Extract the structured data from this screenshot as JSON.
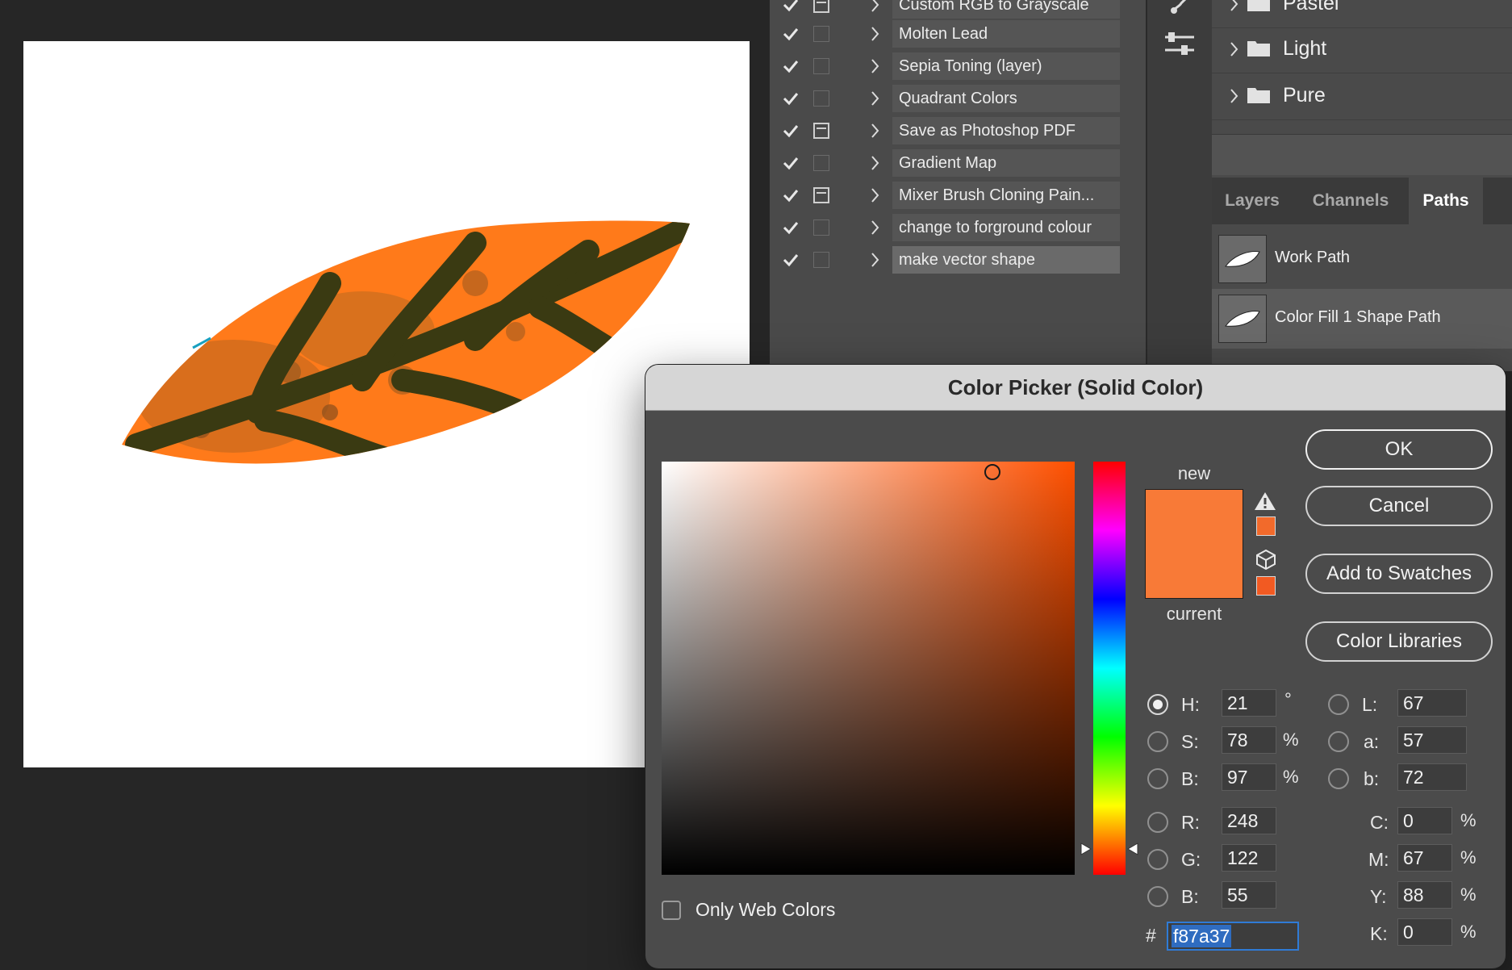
{
  "canvas": {},
  "actions": [
    {
      "label": "Custom RGB to Grayscale",
      "dialog": true
    },
    {
      "label": "Molten Lead",
      "dialog": false
    },
    {
      "label": "Sepia Toning (layer)",
      "dialog": false
    },
    {
      "label": "Quadrant Colors",
      "dialog": false
    },
    {
      "label": "Save as Photoshop PDF",
      "dialog": true
    },
    {
      "label": "Gradient Map",
      "dialog": false
    },
    {
      "label": "Mixer Brush Cloning Pain...",
      "dialog": true
    },
    {
      "label": "change to forground colour",
      "dialog": false
    },
    {
      "label": "make vector shape",
      "dialog": false,
      "selected": true
    }
  ],
  "swatch_groups": [
    "Pastel",
    "Light",
    "Pure"
  ],
  "panel_tabs": [
    "Layers",
    "Channels",
    "Paths"
  ],
  "paths": [
    "Work Path",
    "Color Fill 1 Shape Path"
  ],
  "dialog": {
    "title": "Color Picker (Solid Color)",
    "new_label": "new",
    "current_label": "current",
    "buttons": {
      "ok": "OK",
      "cancel": "Cancel",
      "add_swatches": "Add to Swatches",
      "color_libraries": "Color Libraries"
    },
    "hsb": {
      "h": {
        "label": "H:",
        "value": "21",
        "unit": "°"
      },
      "s": {
        "label": "S:",
        "value": "78",
        "unit": "%"
      },
      "b": {
        "label": "B:",
        "value": "97",
        "unit": "%"
      }
    },
    "rgb": {
      "r": {
        "label": "R:",
        "value": "248"
      },
      "g": {
        "label": "G:",
        "value": "122"
      },
      "b": {
        "label": "B:",
        "value": "55"
      }
    },
    "lab": {
      "l": {
        "label": "L:",
        "value": "67"
      },
      "a": {
        "label": "a:",
        "value": "57"
      },
      "b": {
        "label": "b:",
        "value": "72"
      }
    },
    "cmyk": {
      "c": {
        "label": "C:",
        "value": "0",
        "unit": "%"
      },
      "m": {
        "label": "M:",
        "value": "67",
        "unit": "%"
      },
      "y": {
        "label": "Y:",
        "value": "88",
        "unit": "%"
      },
      "k": {
        "label": "K:",
        "value": "0",
        "unit": "%"
      }
    },
    "hex_hash": "#",
    "hex": "f87a37",
    "only_web_colors": "Only Web Colors",
    "colors": {
      "new": "#f87a37",
      "gamut": "#f26a2b",
      "web": "#f25a22"
    }
  }
}
